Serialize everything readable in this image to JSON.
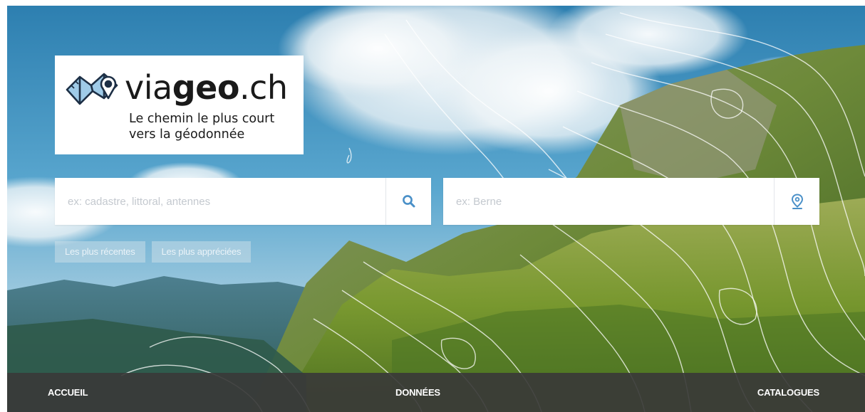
{
  "brand": {
    "name_part1": "via",
    "name_part2": "geo",
    "name_part3": ".ch",
    "tagline_line1": "Le chemin le plus court",
    "tagline_line2": "vers la géodonnée",
    "logo_icon": "folded-map-pin-icon"
  },
  "search": {
    "what_placeholder": "ex: cadastre, littoral, antennes",
    "what_value": "",
    "what_button_icon": "search-icon",
    "where_placeholder": "ex: Berne",
    "where_value": "",
    "where_button_icon": "location-pin-icon"
  },
  "quick_links": [
    {
      "label": "Les plus récentes"
    },
    {
      "label": "Les plus appréciées"
    }
  ],
  "nav": [
    {
      "label": "ACCUEIL"
    },
    {
      "label": "DONNÉES"
    },
    {
      "label": "CATALOGUES"
    }
  ],
  "colors": {
    "accent": "#4a90c8",
    "navbar": "#3a3a38",
    "search_placeholder": "#c4c9cf"
  },
  "background": {
    "description": "mountain landscape with topographic contour lines",
    "decorative": true
  }
}
